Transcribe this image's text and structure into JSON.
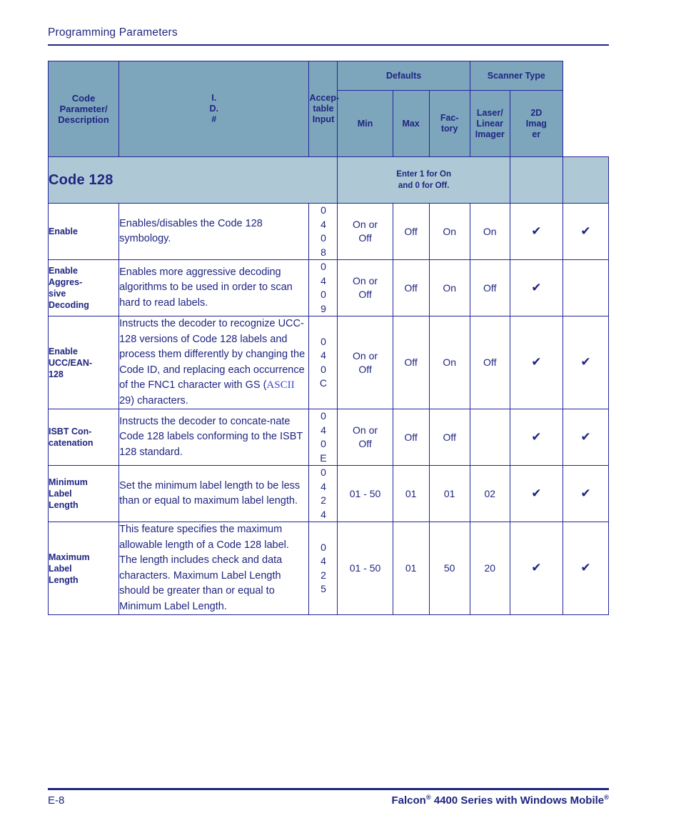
{
  "running_header": {
    "title": "Programming Parameters"
  },
  "table": {
    "headers": {
      "code_parameter": "Code Parameter/ Description",
      "id": [
        "I.",
        "D.",
        "#"
      ],
      "acceptable_input": [
        "Accep-",
        "table",
        "Input"
      ],
      "defaults_group": "Defaults",
      "scanner_type_group": "Scanner Type",
      "min": "Min",
      "max": "Max",
      "factory": [
        "Fac-",
        "tory"
      ],
      "laser_linear_imager": [
        "Laser/",
        "Linear",
        "Imager"
      ],
      "two_d_imager": [
        "2D",
        "Imag",
        "er"
      ]
    },
    "section": {
      "title": "Code 128",
      "note_line1": "Enter 1 for On",
      "note_line2": "and 0 for Off."
    },
    "rows": [
      {
        "parameter": "Enable",
        "description": "Enables/disables the Code 128 symbology.",
        "id": [
          "0",
          "4",
          "0",
          "8"
        ],
        "acceptable_input": [
          "On or",
          "Off"
        ],
        "min": "Off",
        "max": "On",
        "factory": "On",
        "laser_linear_imager": "check",
        "two_d_imager": "check"
      },
      {
        "parameter": "Enable Aggres- sive Decoding",
        "parameter_lines": [
          "Enable",
          "Aggres-",
          "sive",
          "Decoding"
        ],
        "description": "Enables more aggressive decoding algorithms to be used in order to scan hard to read labels.",
        "id": [
          "0",
          "4",
          "0",
          "9"
        ],
        "acceptable_input": [
          "On or",
          "Off"
        ],
        "min": "Off",
        "max": "On",
        "factory": "Off",
        "laser_linear_imager": "check",
        "two_d_imager": ""
      },
      {
        "parameter": "Enable UCC/EAN- 128",
        "parameter_lines": [
          "Enable",
          "UCC/EAN-",
          "128"
        ],
        "description_part1": "Instructs the decoder to recognize UCC-128 versions of Code 128 labels and process them differently by changing the Code ID, and replacing each occurrence of the FNC1 character with GS (",
        "description_xref": "ASCII",
        "description_part2": " 29) characters.",
        "id": [
          "0",
          "4",
          "0",
          "C"
        ],
        "acceptable_input": [
          "On or",
          "Off"
        ],
        "min": "Off",
        "max": "On",
        "factory": "Off",
        "laser_linear_imager": "check",
        "two_d_imager": "check"
      },
      {
        "parameter": "ISBT Con- catenation",
        "parameter_lines": [
          "ISBT Con-",
          "catenation"
        ],
        "description": "Instructs the decoder to concate-nate Code 128 labels conforming to the ISBT 128 standard.",
        "id": [
          "0",
          "4",
          "0",
          "E"
        ],
        "acceptable_input": [
          "On or",
          "Off"
        ],
        "min": "Off",
        "max": "Off",
        "factory": "",
        "laser_linear_imager": "check",
        "two_d_imager": "check"
      },
      {
        "parameter": "Minimum Label Length",
        "parameter_lines": [
          "Minimum",
          "Label",
          "Length"
        ],
        "description": "Set the minimum label length to be less than or equal to maximum label length.",
        "id": [
          "0",
          "4",
          "2",
          "4"
        ],
        "acceptable_input": [
          "01 - 50"
        ],
        "min": "01",
        "max": "01",
        "factory": "02",
        "laser_linear_imager": "check",
        "two_d_imager": "check"
      },
      {
        "parameter": "Maximum Label Length",
        "parameter_lines": [
          "Maximum",
          "Label",
          "Length"
        ],
        "description": "This feature specifies the maximum allowable length of a Code 128 label. The length includes check and data characters. Maximum Label Length should be greater than or equal to Minimum Label Length.",
        "id": [
          "0",
          "4",
          "2",
          "5"
        ],
        "acceptable_input": [
          "01 - 50"
        ],
        "min": "01",
        "max": "50",
        "factory": "20",
        "laser_linear_imager": "check",
        "two_d_imager": "check"
      }
    ],
    "check_glyph": "✔"
  },
  "footer": {
    "page_number": "E-8",
    "doc_title_part1": "Falcon",
    "doc_title_reg1": "®",
    "doc_title_part2": " 4400 Series with Windows Mobile",
    "doc_title_reg2": "®"
  },
  "colors": {
    "header_band": "#7da6bd",
    "section_band": "#aec8d6",
    "text_navy": "#1f2580",
    "border_navy": "#23249c",
    "xref_blue": "#3a46d8"
  }
}
